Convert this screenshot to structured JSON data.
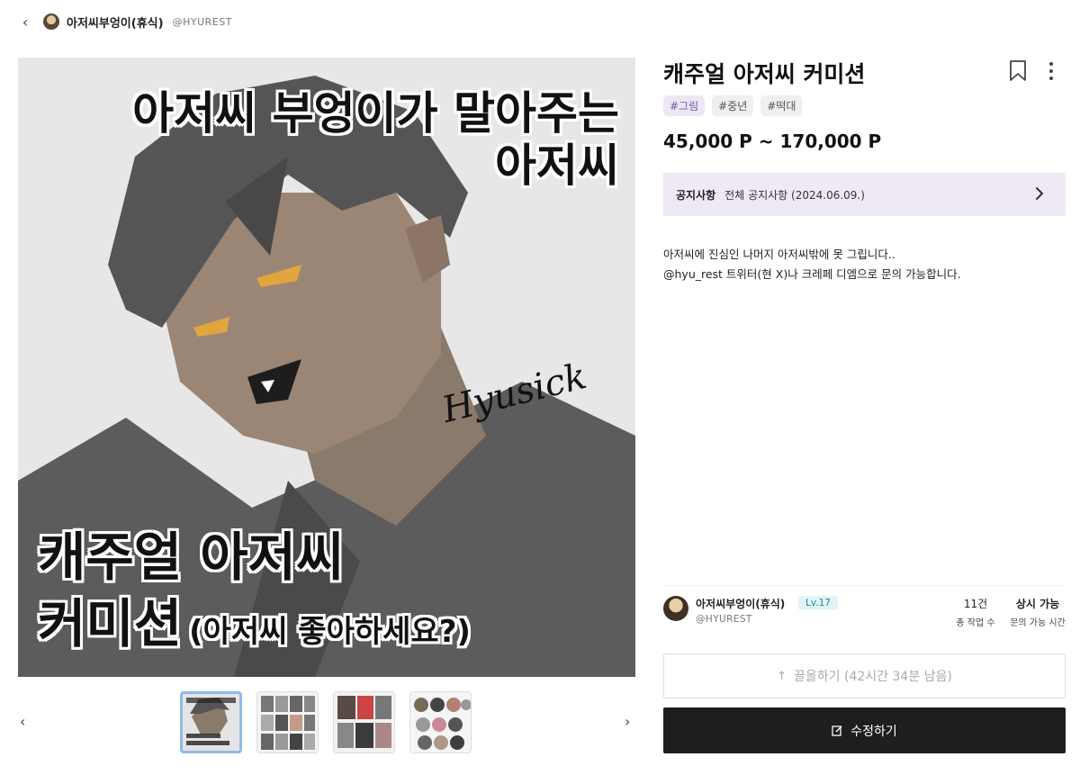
{
  "header": {
    "back_icon": "chevron-left-icon",
    "name": "아저씨부엉이(휴식)",
    "handle": "@HYUREST"
  },
  "main_image": {
    "caption_line1": "아저씨 부엉이가 말아주는",
    "caption_line2": "아저씨",
    "caption_line3": "캐주얼 아저씨",
    "caption_line4": "커미션",
    "caption_line4_small": "(아저씨 좋아하세요?)",
    "signature": "Hyusick"
  },
  "thumbnails": {
    "prev_icon": "chevron-left-icon",
    "next_icon": "chevron-right-icon",
    "count": 4,
    "active_index": 0
  },
  "product": {
    "title": "캐주얼 아저씨 커미션",
    "tags": [
      "#그림",
      "#중년",
      "#떡대"
    ],
    "price": "45,000 P ~ 170,000 P"
  },
  "notice": {
    "label": "공지사항",
    "text": "전체 공지사항 (2024.06.09.)"
  },
  "description": {
    "line1": "아저씨에 진심인 나머지 아저씨밖에 못 그립니다..",
    "line2": "@hyu_rest 트위터(현 X)나 크레페 디엠으로 문의 가능합니다."
  },
  "author": {
    "name": "아저씨부엉이(휴식)",
    "level": "Lv.17",
    "handle": "@HYUREST",
    "works_value": "11건",
    "works_label": "총 작업 수",
    "inquiry_value": "상시 가능",
    "inquiry_label": "문의 가능 시간"
  },
  "actions": {
    "bump_label": "끌올하기 (42시간 34분 남음)",
    "edit_label": "수정하기"
  },
  "colors": {
    "notice_bg": "#efe9f6",
    "tag_active": "#7a5aa8",
    "edit_button_bg": "#1e1e1e",
    "level_bg": "#e3f4f7"
  }
}
